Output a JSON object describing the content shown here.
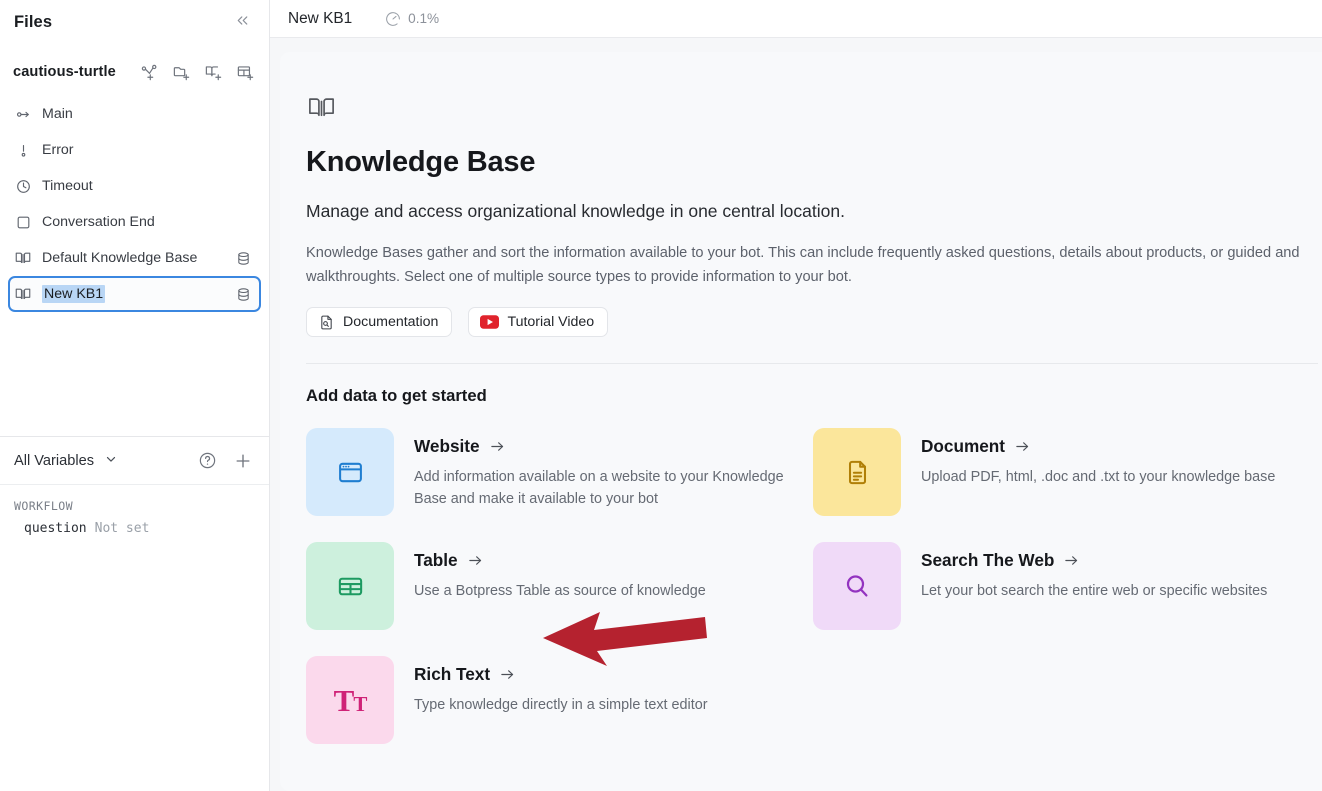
{
  "sidebar": {
    "title": "Files",
    "collapse_icon": "chevron-double-left-icon",
    "bot_name": "cautious-turtle",
    "bot_actions": [
      {
        "name": "add-workflow-icon",
        "label": "Add Workflow"
      },
      {
        "name": "add-folder-icon",
        "label": "Add Folder"
      },
      {
        "name": "add-knowledge-base-icon",
        "label": "Add Knowledge Base"
      },
      {
        "name": "add-table-icon",
        "label": "Add Table"
      }
    ],
    "items": [
      {
        "label": "Main",
        "icon": "flow-start-icon",
        "trailing": "",
        "selected": false
      },
      {
        "label": "Error",
        "icon": "error-icon",
        "trailing": "",
        "selected": false
      },
      {
        "label": "Timeout",
        "icon": "clock-icon",
        "trailing": "",
        "selected": false
      },
      {
        "label": "Conversation End",
        "icon": "square-icon",
        "trailing": "",
        "selected": false
      },
      {
        "label": "Default Knowledge Base",
        "icon": "book-icon",
        "trailing": "database-icon",
        "selected": false
      },
      {
        "label": "New KB1",
        "icon": "book-icon",
        "trailing": "database-icon",
        "selected": true
      }
    ],
    "variables": {
      "title": "All Variables",
      "caret_icon": "chevron-down-icon",
      "help_icon": "help-circle-icon",
      "add_icon": "plus-icon",
      "group_label": "WORKFLOW",
      "rows": [
        {
          "name": "question",
          "value": "Not set"
        }
      ]
    }
  },
  "topbar": {
    "tab_label": "New KB1",
    "gauge_icon": "gauge-icon",
    "gauge_value": "0.1%",
    "close_icon": "close-icon"
  },
  "page": {
    "header_icon": "book-icon",
    "title": "Knowledge Base",
    "subtitle": "Manage and access organizational knowledge in one central location.",
    "paragraph": "Knowledge Bases gather and sort the information available to your bot. This can include frequently asked questions, details about products, or guided and walkthroughts. Select one of multiple source types to provide information to your bot.",
    "links": [
      {
        "label": "Documentation",
        "icon": "file-search-icon"
      },
      {
        "label": "Tutorial Video",
        "icon": "youtube-icon"
      }
    ],
    "section_title": "Add data to get started",
    "cards": [
      {
        "title": "Website",
        "description": "Add information available on a website to your Knowledge Base and make it available to your bot",
        "icon": "browser-window-icon",
        "tile_class": "tile-blue",
        "tile_color": "#d5eafc",
        "icon_color": "#1f7ed0",
        "arrow_icon": "arrow-right-icon"
      },
      {
        "title": "Document",
        "description": "Upload PDF, html, .doc and .txt to your knowledge base",
        "icon": "document-icon",
        "tile_class": "tile-yellow",
        "tile_color": "#fbe69b",
        "icon_color": "#b07f07",
        "arrow_icon": "arrow-right-icon"
      },
      {
        "title": "Table",
        "description": "Use a Botpress Table as source of knowledge",
        "icon": "table-icon",
        "tile_class": "tile-green",
        "tile_color": "#cdf0dd",
        "icon_color": "#1d9a61",
        "arrow_icon": "arrow-right-icon"
      },
      {
        "title": "Search The Web",
        "description": "Let your bot search the entire web or specific websites",
        "icon": "search-icon",
        "tile_class": "tile-purple",
        "tile_color": "#f0daf8",
        "icon_color": "#9333c0",
        "arrow_icon": "arrow-right-icon"
      },
      {
        "title": "Rich Text",
        "description": "Type knowledge directly in a simple text editor",
        "icon": "rich-text-icon",
        "tile_class": "tile-pink",
        "tile_color": "#fbd9ec",
        "icon_color": "#cf2277",
        "arrow_icon": "arrow-right-icon"
      }
    ]
  },
  "annotation": {
    "name": "red-arrow-pointing-to-rich-text",
    "color": "#b5222f"
  }
}
